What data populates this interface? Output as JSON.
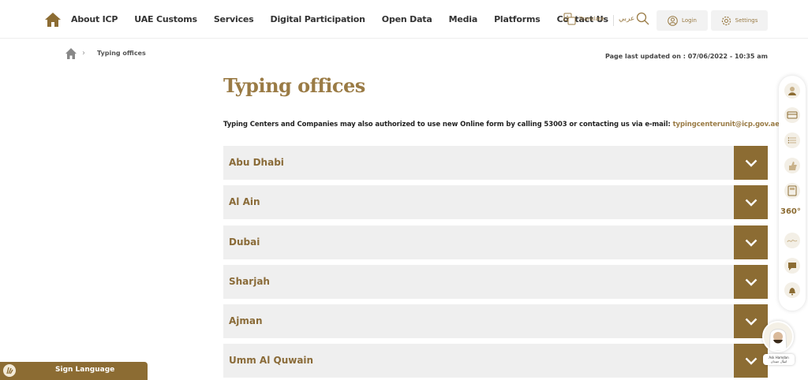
{
  "header": {
    "nav": [
      "About ICP",
      "UAE Customs",
      "Services",
      "Digital Participation",
      "Open Data",
      "Media",
      "Platforms",
      "Contact Us"
    ],
    "translate_label": "Translate",
    "arabic_label": "عربي",
    "login_label": "Login",
    "settings_label": "Settings"
  },
  "breadcrumb": {
    "current": "Typing offices"
  },
  "updated": "Page last updated on : 07/06/2022 - 10:35 am",
  "page": {
    "title": "Typing offices",
    "intro_text": "Typing Centers and Companies may also authorized to use new Online form by calling 53003 or contacting us via e-mail: ",
    "intro_email": "typingcenterunit@icp.gov.ae"
  },
  "accordion": [
    "Abu Dhabi",
    "Al Ain",
    "Dubai",
    "Sharjah",
    "Ajman",
    "Umm Al Quwain"
  ],
  "side_toolbar": {
    "icons": [
      "ask-hamdan-icon",
      "card-icon",
      "list-icon",
      "rating-icon",
      "calculator-icon",
      "view-360-icon",
      "signature-icon",
      "chat-icon",
      "bell-icon"
    ],
    "label_360": "360°"
  },
  "bot": {
    "label_en": "Ask Hamdan",
    "label_ar": "اسأل حمدان"
  },
  "sign_language": {
    "label": "Sign Language"
  },
  "colors": {
    "accent": "#8c6c33",
    "accent_text": "#9a7b45",
    "panel": "#efefef"
  }
}
